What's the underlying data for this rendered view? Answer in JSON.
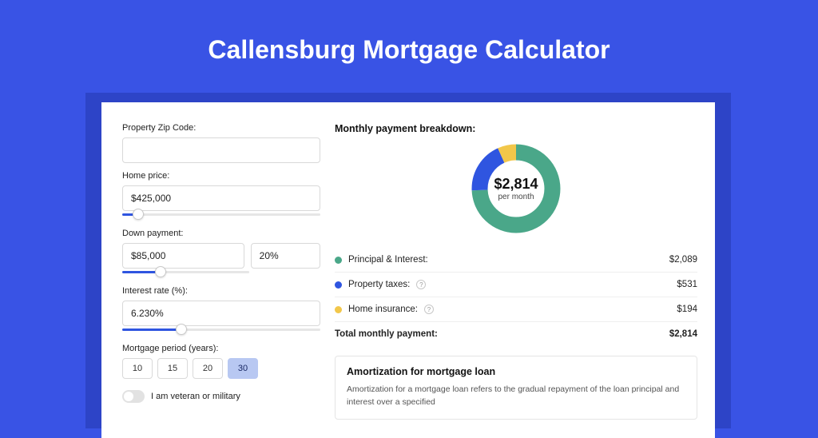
{
  "hero": {
    "title": "Callensburg Mortgage Calculator"
  },
  "form": {
    "zip": {
      "label": "Property Zip Code:",
      "value": ""
    },
    "price": {
      "label": "Home price:",
      "value": "$425,000"
    },
    "down": {
      "label": "Down payment:",
      "value": "$85,000",
      "pct": "20%"
    },
    "rate": {
      "label": "Interest rate (%):",
      "value": "6.230%"
    },
    "period": {
      "label": "Mortgage period (years):",
      "options": [
        "10",
        "15",
        "20",
        "30"
      ],
      "selected": "30"
    },
    "veteran": {
      "label": "I am veteran or military",
      "on": false
    }
  },
  "breakdown": {
    "title": "Monthly payment breakdown:",
    "center_amount": "$2,814",
    "center_sub": "per month",
    "items": [
      {
        "label": "Principal & Interest:",
        "value": "$2,089",
        "color": "#4aa789"
      },
      {
        "label": "Property taxes:",
        "value": "$531",
        "color": "#2f55e0",
        "help": true
      },
      {
        "label": "Home insurance:",
        "value": "$194",
        "color": "#f2c74a",
        "help": true
      }
    ],
    "total": {
      "label": "Total monthly payment:",
      "value": "$2,814"
    }
  },
  "chart_data": {
    "type": "pie",
    "title": "Monthly payment breakdown",
    "categories": [
      "Principal & Interest",
      "Property taxes",
      "Home insurance"
    ],
    "values": [
      2089,
      531,
      194
    ],
    "colors": [
      "#4aa789",
      "#2f55e0",
      "#f2c74a"
    ],
    "total": 2814
  },
  "amort": {
    "title": "Amortization for mortgage loan",
    "text": "Amortization for a mortgage loan refers to the gradual repayment of the loan principal and interest over a specified"
  }
}
